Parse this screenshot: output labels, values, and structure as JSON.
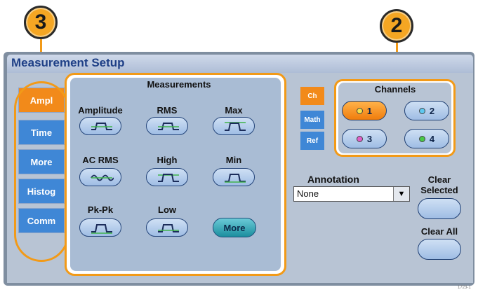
{
  "callouts": {
    "left": "3",
    "right": "2"
  },
  "window": {
    "title": "Measurement Setup"
  },
  "tabs": [
    {
      "label": "Ampl",
      "active": true
    },
    {
      "label": "Time",
      "active": false
    },
    {
      "label": "More",
      "active": false
    },
    {
      "label": "Histog",
      "active": false
    },
    {
      "label": "Comm",
      "active": false
    }
  ],
  "measurements": {
    "heading": "Measurements",
    "items": [
      {
        "label": "Amplitude",
        "icon": "amplitude-waveform-icon"
      },
      {
        "label": "RMS",
        "icon": "rms-waveform-icon"
      },
      {
        "label": "Max",
        "icon": "max-waveform-icon"
      },
      {
        "label": "AC RMS",
        "icon": "ac-rms-waveform-icon"
      },
      {
        "label": "High",
        "icon": "high-waveform-icon"
      },
      {
        "label": "Min",
        "icon": "min-waveform-icon"
      },
      {
        "label": "Pk-Pk",
        "icon": "pk-pk-waveform-icon"
      },
      {
        "label": "Low",
        "icon": "low-waveform-icon"
      }
    ],
    "more_label": "More"
  },
  "source_tabs": [
    {
      "label": "Ch",
      "active": true
    },
    {
      "label": "Math",
      "active": false
    },
    {
      "label": "Ref",
      "active": false
    }
  ],
  "channels": {
    "heading": "Channels",
    "items": [
      {
        "label": "1",
        "selected": true,
        "color": "#f4e04a"
      },
      {
        "label": "2",
        "selected": false,
        "color": "#5ec8f0"
      },
      {
        "label": "3",
        "selected": false,
        "color": "#e060c8"
      },
      {
        "label": "4",
        "selected": false,
        "color": "#48c848"
      }
    ]
  },
  "annotation": {
    "label": "Annotation",
    "value": "None"
  },
  "clear_selected_label": "Clear\nSelected",
  "clear_all_label": "Clear All",
  "footer": "1723-1",
  "colors": {
    "accent": "#f29a18",
    "tab_active": "#f28a1a",
    "tab_inactive": "#3f87d6",
    "title_text": "#1e3f86"
  }
}
